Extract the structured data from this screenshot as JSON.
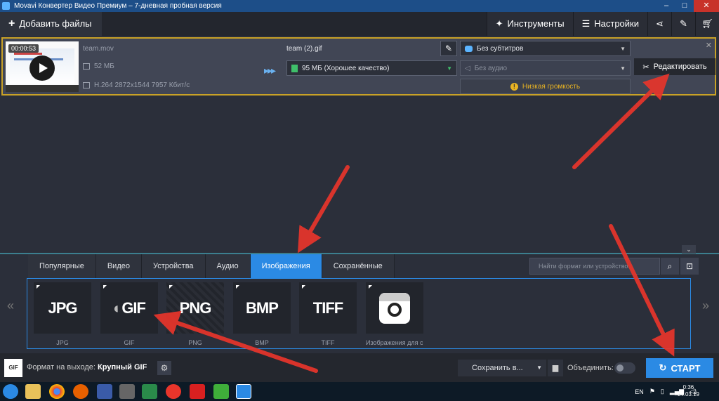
{
  "window": {
    "title": "Movavi Конвертер Видео Премиум – 7-дневная пробная версия",
    "controls": [
      "–",
      "□",
      "✕"
    ]
  },
  "toolbar": {
    "add_files": "Добавить файлы",
    "tools": "Инструменты",
    "settings": "Настройки"
  },
  "file": {
    "duration": "00:00:53",
    "source_name": "team.mov",
    "source_size": "52 МБ",
    "source_codec": "H.264 2872x1544 7957 Кбит/с",
    "output_name": "team (2).gif",
    "output_format": "95 МБ (Хорошее качество)",
    "subtitles": "Без субтитров",
    "audio": "Без аудио",
    "volume_warning": "Низкая громкость",
    "edit_button": "Редактировать"
  },
  "tabs": [
    {
      "label": "Популярные",
      "active": false
    },
    {
      "label": "Видео",
      "active": false
    },
    {
      "label": "Устройства",
      "active": false
    },
    {
      "label": "Аудио",
      "active": false
    },
    {
      "label": "Изображения",
      "active": true
    },
    {
      "label": "Сохранённые",
      "active": false
    }
  ],
  "search": {
    "placeholder": "Найти формат или устройство..."
  },
  "formats": [
    {
      "tile": "JPG",
      "label": "JPG"
    },
    {
      "tile": "GIF",
      "label": "GIF"
    },
    {
      "tile": "PNG",
      "label": "PNG"
    },
    {
      "tile": "BMP",
      "label": "BMP"
    },
    {
      "tile": "TIFF",
      "label": "TIFF"
    },
    {
      "tile": "",
      "label": "Изображения для с..."
    }
  ],
  "bottom": {
    "gif_icon": "GIF",
    "output_format_label": "Формат на выходе:",
    "output_format_value": "Крупный GIF",
    "save_in": "Сохранить в...",
    "merge": "Объединить:",
    "start": "СТАРТ"
  },
  "taskbar": {
    "lang": "EN",
    "time": "0:36",
    "date": "04.03.19"
  },
  "colors": {
    "accent": "#2b8ae4",
    "highlight_border": "#c9a227",
    "warning": "#e8b323",
    "annotation": "#e8352b"
  }
}
